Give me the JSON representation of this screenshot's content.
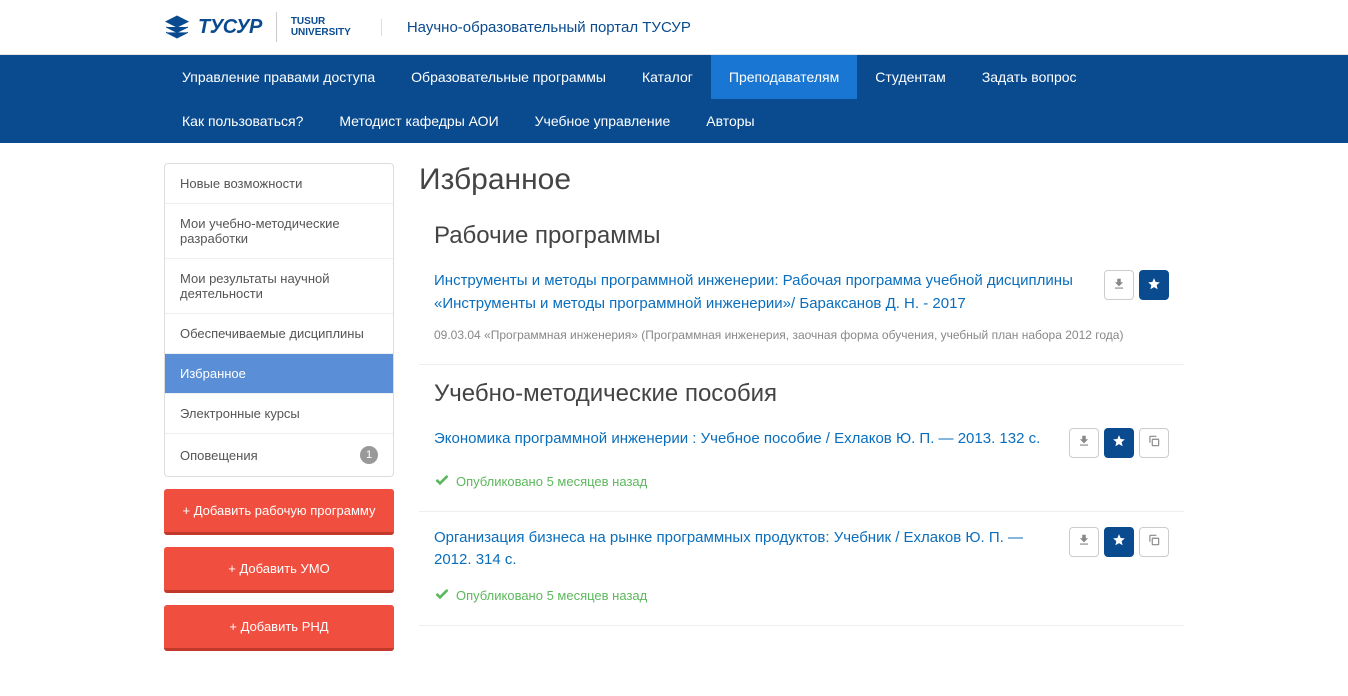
{
  "header": {
    "logo_text": "ТУСУР",
    "logo_sub1": "TUSUR",
    "logo_sub2": "UNIVERSITY",
    "title": "Научно-образовательный портал ТУСУР"
  },
  "nav": {
    "items": [
      {
        "label": "Управление правами доступа",
        "active": false
      },
      {
        "label": "Образовательные программы",
        "active": false
      },
      {
        "label": "Каталог",
        "active": false
      },
      {
        "label": "Преподавателям",
        "active": true
      },
      {
        "label": "Студентам",
        "active": false
      },
      {
        "label": "Задать вопрос",
        "active": false
      },
      {
        "label": "Как пользоваться?",
        "active": false
      },
      {
        "label": "Методист кафедры АОИ",
        "active": false
      },
      {
        "label": "Учебное управление",
        "active": false
      },
      {
        "label": "Авторы",
        "active": false
      }
    ]
  },
  "sidebar": {
    "items": [
      {
        "label": "Новые возможности",
        "active": false,
        "badge": null
      },
      {
        "label": "Мои учебно-методические разработки",
        "active": false,
        "badge": null
      },
      {
        "label": "Мои результаты научной деятельности",
        "active": false,
        "badge": null
      },
      {
        "label": "Обеспечиваемые дисциплины",
        "active": false,
        "badge": null
      },
      {
        "label": "Избранное",
        "active": true,
        "badge": null
      },
      {
        "label": "Электронные курсы",
        "active": false,
        "badge": null
      },
      {
        "label": "Оповещения",
        "active": false,
        "badge": "1"
      }
    ],
    "actions": [
      {
        "label": "+ Добавить рабочую программу"
      },
      {
        "label": "+ Добавить УМО"
      },
      {
        "label": "+ Добавить РНД"
      }
    ]
  },
  "main": {
    "title": "Избранное",
    "sections": [
      {
        "heading": "Рабочие программы",
        "items": [
          {
            "title": "Инструменты и методы программной инженерии: Рабочая программа учебной дисциплины «Инструменты и методы программной инженерии»/ Бараксанов Д. Н. - 2017",
            "meta": "09.03.04 «Программная инженерия» (Программная инженерия, заочная форма обучения, учебный план набора 2012 года)",
            "status": null,
            "actions": [
              "download",
              "star"
            ]
          }
        ]
      },
      {
        "heading": "Учебно-методические пособия",
        "items": [
          {
            "title": "Экономика программной инженерии : Учебное пособие / Ехлаков Ю. П. — 2013. 132 с.",
            "meta": null,
            "status": "Опубликовано 5 месяцев назад",
            "actions": [
              "download",
              "star",
              "copy"
            ]
          },
          {
            "title": "Организация бизнеса на рынке программных продуктов: Учебник / Ехлаков Ю. П. — 2012. 314 с.",
            "meta": null,
            "status": "Опубликовано 5 месяцев назад",
            "actions": [
              "download",
              "star",
              "copy"
            ]
          }
        ]
      }
    ]
  }
}
